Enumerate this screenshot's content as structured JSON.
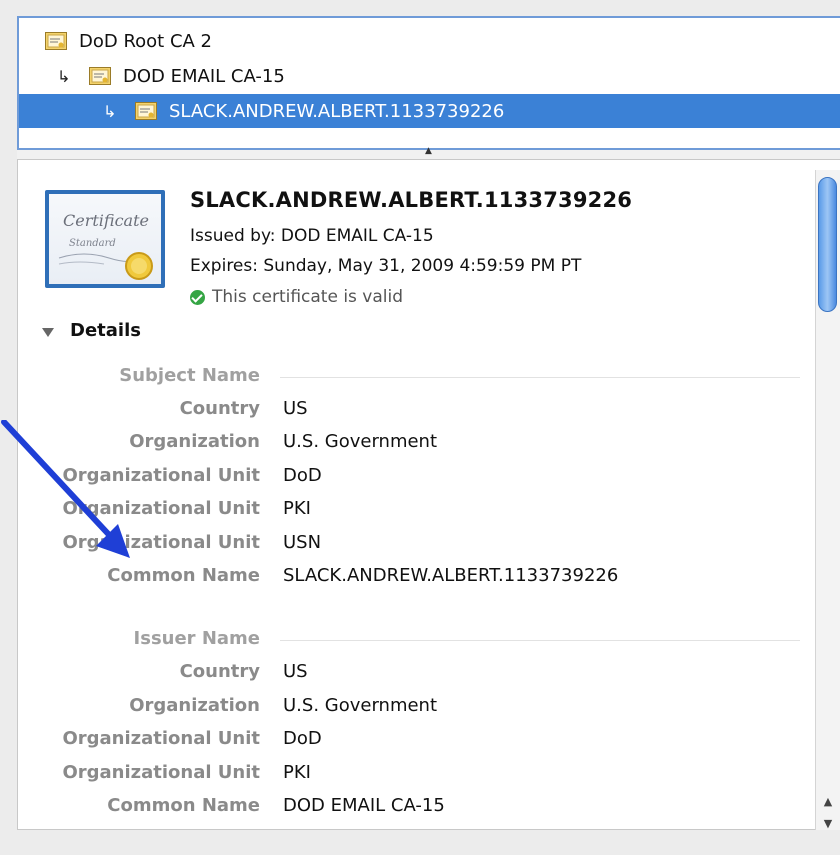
{
  "chain": [
    {
      "label": "DoD Root CA 2",
      "indent": 0,
      "selected": false
    },
    {
      "label": "DOD EMAIL CA-15",
      "indent": 1,
      "selected": false
    },
    {
      "label": "SLACK.ANDREW.ALBERT.1133739226",
      "indent": 2,
      "selected": true
    }
  ],
  "arrow_glyph": "↳",
  "certificate": {
    "badge_text": [
      "Certificate",
      "Standard"
    ],
    "name": "SLACK.ANDREW.ALBERT.1133739226",
    "issued_by": "Issued by: DOD EMAIL CA-15",
    "expires": "Expires: Sunday, May 31, 2009 4:59:59 PM PT",
    "valid_text": "This certificate is valid"
  },
  "details": {
    "toggle_label": "Details",
    "subject": {
      "header": "Subject Name",
      "fields": [
        {
          "label": "Country",
          "value": "US"
        },
        {
          "label": "Organization",
          "value": "U.S. Government"
        },
        {
          "label": "Organizational Unit",
          "value": "DoD"
        },
        {
          "label": "Organizational Unit",
          "value": "PKI"
        },
        {
          "label": "Organizational Unit",
          "value": "USN"
        },
        {
          "label": "Common Name",
          "value": "SLACK.ANDREW.ALBERT.1133739226"
        }
      ]
    },
    "issuer": {
      "header": "Issuer Name",
      "fields": [
        {
          "label": "Country",
          "value": "US"
        },
        {
          "label": "Organization",
          "value": "U.S. Government"
        },
        {
          "label": "Organizational Unit",
          "value": "DoD"
        },
        {
          "label": "Organizational Unit",
          "value": "PKI"
        },
        {
          "label": "Common Name",
          "value": "DOD EMAIL CA-15"
        }
      ]
    }
  },
  "colors": {
    "selection": "#3b81d6",
    "annotation_arrow": "#1f3fd6",
    "valid_green": "#35a544"
  }
}
